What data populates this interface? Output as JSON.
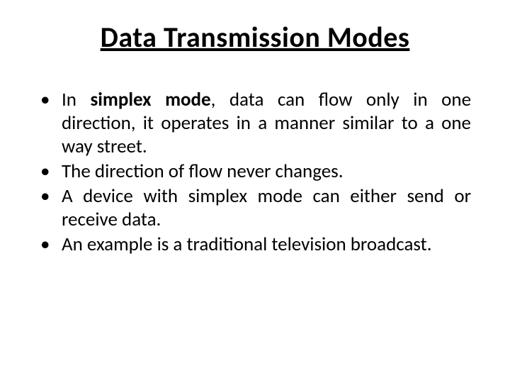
{
  "title": "Data Transmission Modes",
  "bullets": {
    "b1_prefix": "In ",
    "b1_bold": "simplex mode",
    "b1_rest": ", data can flow only in one direction, it operates in a manner similar to a one way street.",
    "b2": "The direction of flow never changes.",
    "b3": "A device with simplex mode can either send or receive data.",
    "b4": "An example is a traditional television broadcast."
  }
}
